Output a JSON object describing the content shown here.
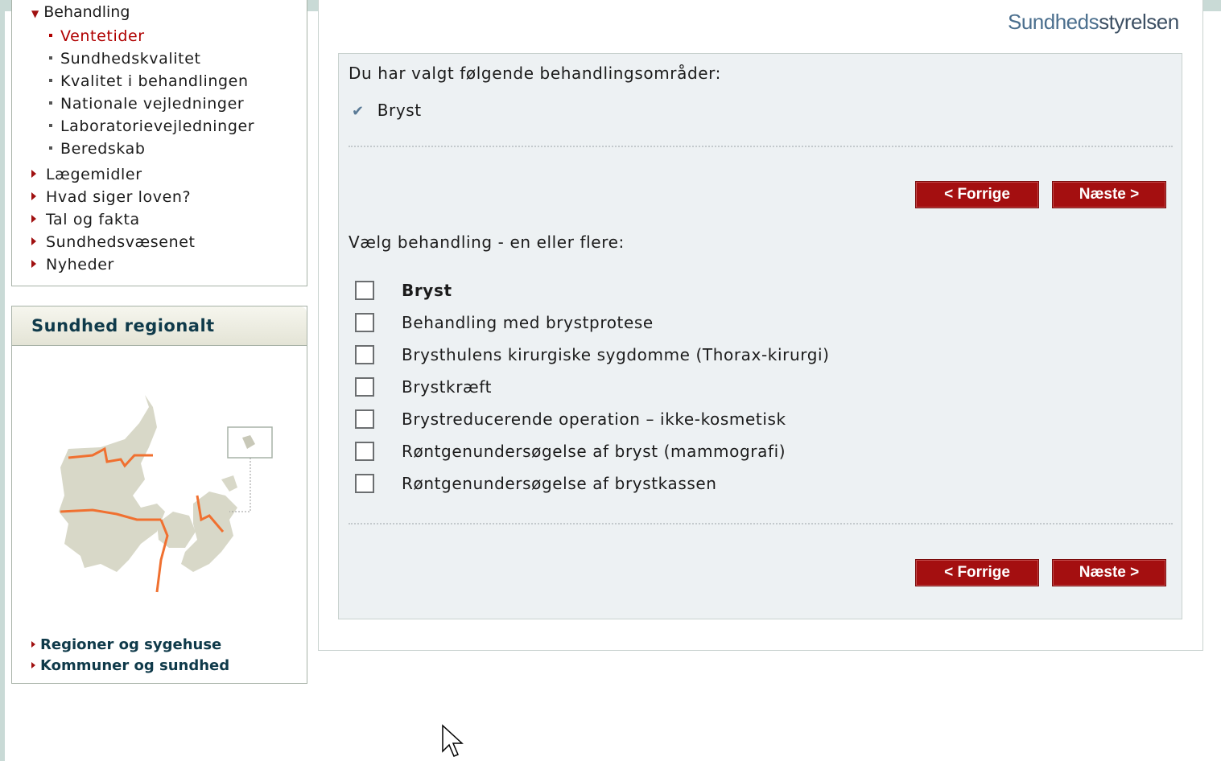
{
  "nav": {
    "parent": "Behandling",
    "sub_items": [
      {
        "label": "Ventetider",
        "active": true
      },
      {
        "label": "Sundhedskvalitet",
        "active": false
      },
      {
        "label": "Kvalitet i behandlingen",
        "active": false
      },
      {
        "label": "Nationale vejledninger",
        "active": false
      },
      {
        "label": "Laboratorievejledninger",
        "active": false
      },
      {
        "label": "Beredskab",
        "active": false
      }
    ],
    "main_items": [
      "Lægemidler",
      "Hvad siger loven?",
      "Tal og fakta",
      "Sundhedsvæsenet",
      "Nyheder"
    ]
  },
  "regional": {
    "title": "Sundhed regionalt",
    "links": [
      "Regioner og sygehuse",
      "Kommuner og sundhed"
    ]
  },
  "logo": {
    "part1": "Sundheds",
    "part2": "styrelsen"
  },
  "main": {
    "chosen_label": "Du har valgt følgende behandlingsområder:",
    "chosen_item": "Bryst",
    "prev_button": "< Forrige",
    "next_button": "Næste >",
    "select_label": "Vælg behandling - en eller flere:",
    "options": [
      {
        "label": "Bryst",
        "bold": true,
        "checked": false
      },
      {
        "label": "Behandling med brystprotese",
        "bold": false,
        "checked": false
      },
      {
        "label": "Brysthulens kirurgiske sygdomme (Thorax-kirurgi)",
        "bold": false,
        "checked": false
      },
      {
        "label": "Brystkræft",
        "bold": false,
        "checked": false
      },
      {
        "label": "Brystreducerende operation – ikke-kosmetisk",
        "bold": false,
        "checked": false
      },
      {
        "label": "Røntgenundersøgelse af bryst (mammografi)",
        "bold": false,
        "checked": false
      },
      {
        "label": "Røntgenundersøgelse af brystkassen",
        "bold": false,
        "checked": false
      }
    ]
  },
  "colors": {
    "accent_red": "#a40f10",
    "nav_active": "#b00000",
    "panel_bg": "#edf1f3",
    "heading_blue": "#0f3a4a"
  }
}
